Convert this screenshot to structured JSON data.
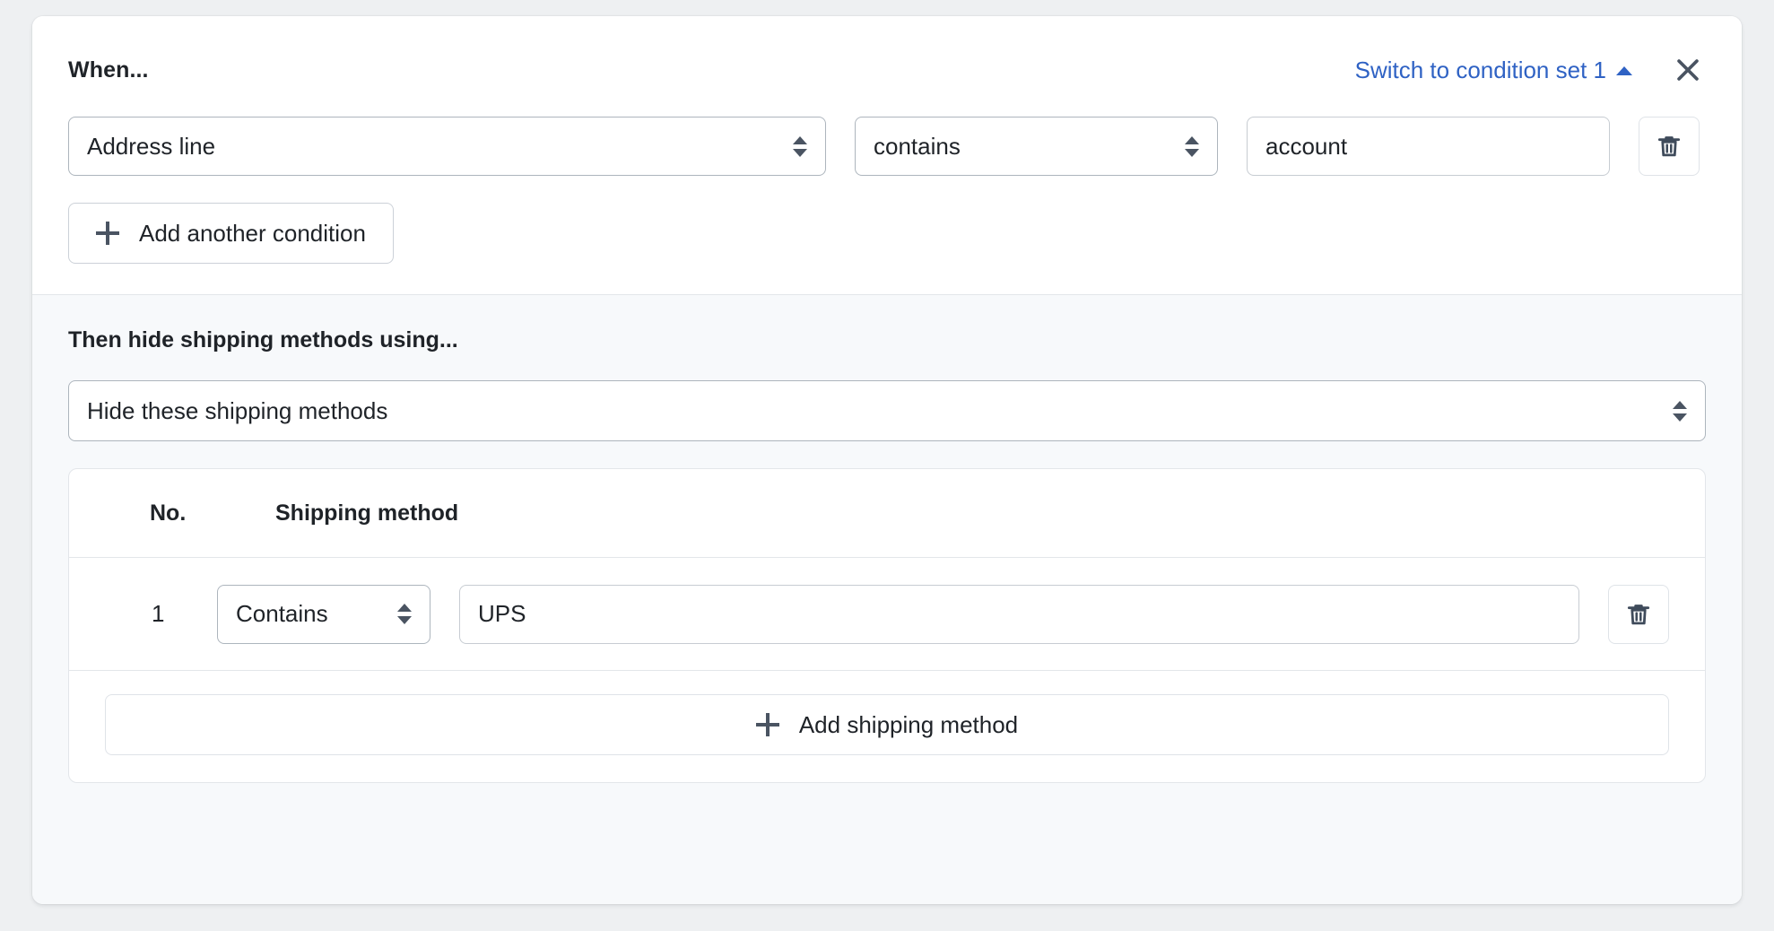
{
  "when": {
    "title": "When...",
    "switch_link": "Switch to condition set 1",
    "switch_caret_icon": "triangle-up-icon",
    "close_icon": "close-icon",
    "condition": {
      "attribute": "Address line",
      "operator": "contains",
      "value": "account",
      "value_placeholder": "",
      "delete_icon": "trash-icon"
    },
    "add_condition_label": "Add another condition",
    "add_icon": "plus-icon"
  },
  "then": {
    "title": "Then hide shipping methods using...",
    "action": "Hide these shipping methods",
    "table": {
      "headers": {
        "no": "No.",
        "method": "Shipping method"
      },
      "rows": [
        {
          "no": "1",
          "operator": "Contains",
          "value": "UPS",
          "value_placeholder": "",
          "delete_icon": "trash-icon"
        }
      ],
      "add_label": "Add shipping method",
      "add_icon": "plus-icon"
    }
  },
  "colors": {
    "link": "#2f62c4",
    "text": "#1f2328",
    "border": "#adb5bd",
    "panel_bg": "#f7f9fb",
    "page_bg": "#eef0f2",
    "icon": "#3f4b5b"
  }
}
